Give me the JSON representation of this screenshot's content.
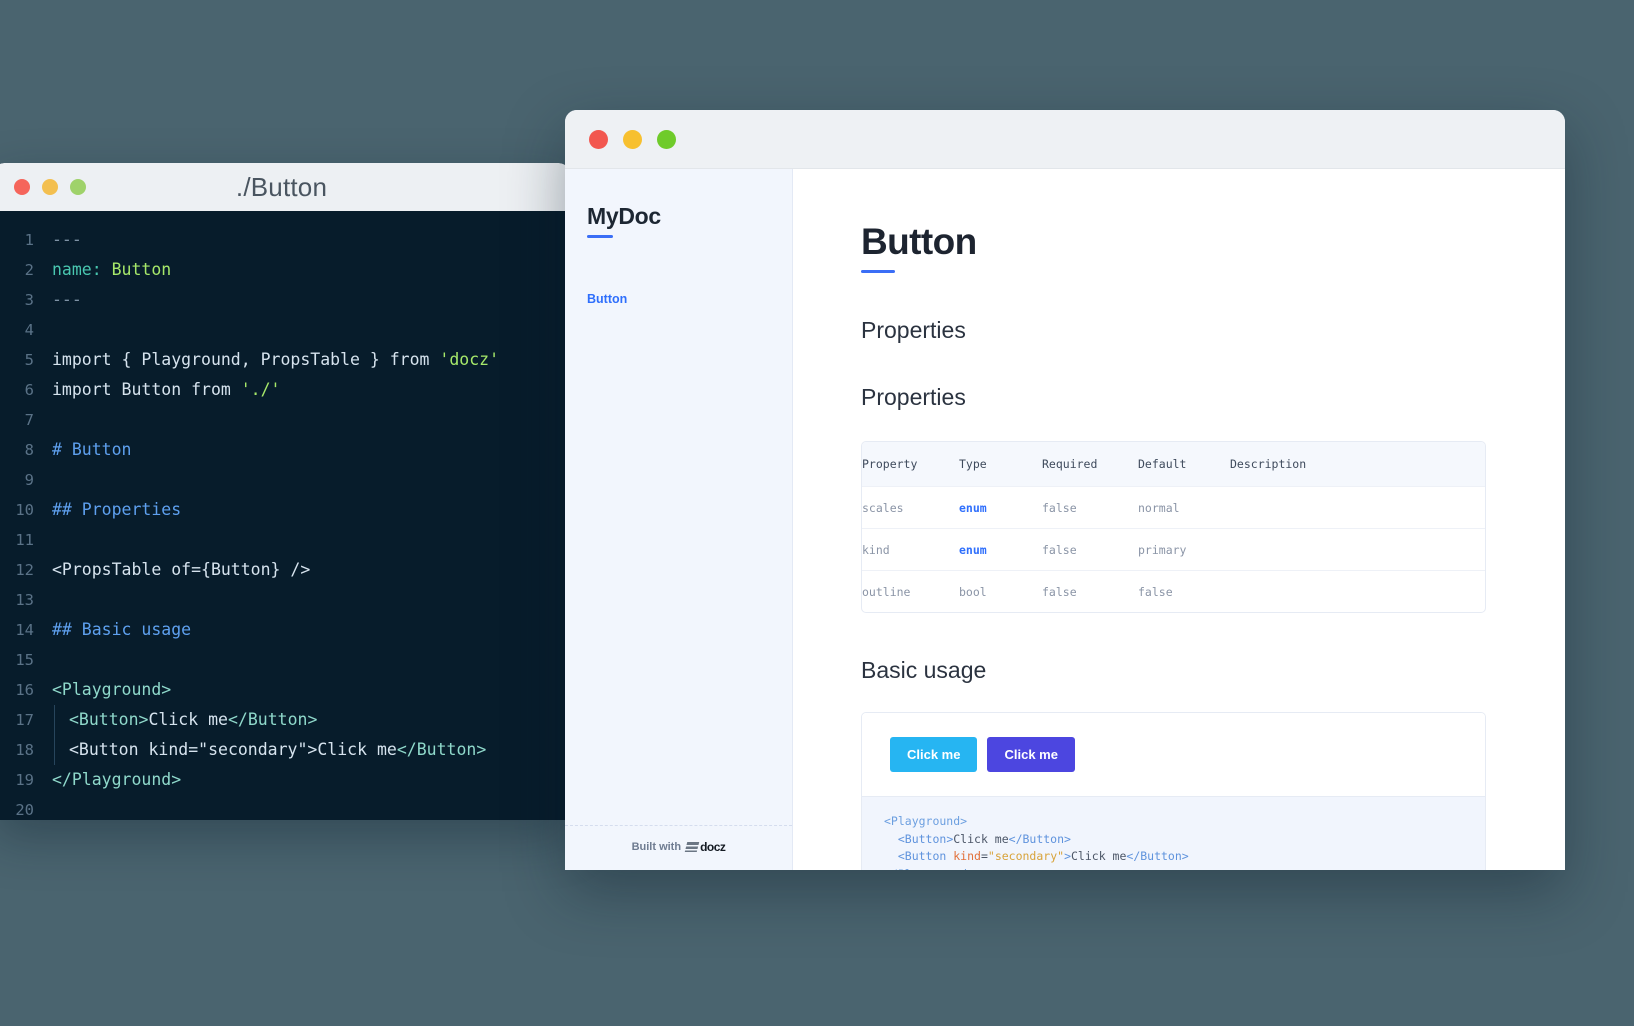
{
  "desktop": {
    "background_color": "#4a646f"
  },
  "editor": {
    "title": "./Button",
    "traffic_lights": [
      "close-red",
      "minimize-yellow",
      "maximize-green"
    ],
    "lines": [
      {
        "n": "1",
        "segs": [
          {
            "t": "---",
            "c": "tok-dim"
          }
        ]
      },
      {
        "n": "2",
        "segs": [
          {
            "t": "name:",
            "c": "tok-key"
          },
          {
            "t": " ",
            "c": "tok-punct"
          },
          {
            "t": "Button",
            "c": "tok-str"
          }
        ]
      },
      {
        "n": "3",
        "segs": [
          {
            "t": "---",
            "c": "tok-dim"
          }
        ]
      },
      {
        "n": "4",
        "segs": []
      },
      {
        "n": "5",
        "segs": [
          {
            "t": "import { Playground, PropsTable } from ",
            "c": "tok-kw"
          },
          {
            "t": "'docz'",
            "c": "tok-str"
          }
        ]
      },
      {
        "n": "6",
        "segs": [
          {
            "t": "import Button from ",
            "c": "tok-kw"
          },
          {
            "t": "'./'",
            "c": "tok-str"
          }
        ]
      },
      {
        "n": "7",
        "segs": []
      },
      {
        "n": "8",
        "segs": [
          {
            "t": "# Button",
            "c": "tok-head"
          }
        ]
      },
      {
        "n": "9",
        "segs": []
      },
      {
        "n": "10",
        "segs": [
          {
            "t": "## Properties",
            "c": "tok-head"
          }
        ]
      },
      {
        "n": "11",
        "segs": []
      },
      {
        "n": "12",
        "segs": [
          {
            "t": "<PropsTable of={Button} />",
            "c": "tok-kw"
          }
        ]
      },
      {
        "n": "13",
        "segs": []
      },
      {
        "n": "14",
        "segs": [
          {
            "t": "## Basic usage",
            "c": "tok-head"
          }
        ]
      },
      {
        "n": "15",
        "segs": []
      },
      {
        "n": "16",
        "segs": [
          {
            "t": "<Playground>",
            "c": "tok-tag"
          }
        ]
      },
      {
        "n": "17",
        "indent": true,
        "segs": [
          {
            "t": "<Button>",
            "c": "tok-tag"
          },
          {
            "t": "Click me",
            "c": "tok-kw"
          },
          {
            "t": "</Button>",
            "c": "tok-tag"
          }
        ]
      },
      {
        "n": "18",
        "indent": true,
        "segs": [
          {
            "t": "<Button kind=",
            "c": "tok-kw"
          },
          {
            "t": "\"secondary\"",
            "c": "tok-kw"
          },
          {
            "t": ">",
            "c": "tok-kw"
          },
          {
            "t": "Click me",
            "c": "tok-kw"
          },
          {
            "t": "</Button>",
            "c": "tok-tag"
          }
        ]
      },
      {
        "n": "19",
        "segs": [
          {
            "t": "</Playground>",
            "c": "tok-tag"
          }
        ]
      },
      {
        "n": "20",
        "segs": []
      }
    ]
  },
  "docz": {
    "traffic_lights": [
      "close-red",
      "minimize-yellow",
      "maximize-green"
    ],
    "sidebar": {
      "brand": "MyDoc",
      "nav_items": [
        {
          "label": "Button",
          "active": true
        }
      ],
      "footer": {
        "built_with": "Built with",
        "logo_text": "docz"
      }
    },
    "main": {
      "page_title": "Button",
      "section_properties_1": "Properties",
      "section_properties_2": "Properties",
      "section_basic_usage": "Basic usage",
      "props_table": {
        "columns": [
          "Property",
          "Type",
          "Required",
          "Default",
          "Description"
        ],
        "rows": [
          {
            "property": "scales",
            "type": "enum",
            "type_is_enum": true,
            "required": "false",
            "default": "normal",
            "description": ""
          },
          {
            "property": "kind",
            "type": "enum",
            "type_is_enum": true,
            "required": "false",
            "default": "primary",
            "description": ""
          },
          {
            "property": "outline",
            "type": "bool",
            "type_is_enum": false,
            "required": "false",
            "default": "false",
            "description": ""
          }
        ]
      },
      "playground": {
        "buttons": [
          {
            "label": "Click me",
            "kind": "primary",
            "color": "#26b5f2"
          },
          {
            "label": "Click me",
            "kind": "secondary",
            "color": "#4c46e0"
          }
        ],
        "code_lines": [
          [
            {
              "t": "<Playground>",
              "c": "pg-tag"
            }
          ],
          [
            {
              "t": "  ",
              "c": "pg-txt"
            },
            {
              "t": "<Button>",
              "c": "pg-tag2"
            },
            {
              "t": "Click me",
              "c": "pg-txt"
            },
            {
              "t": "</Button>",
              "c": "pg-tag2"
            }
          ],
          [
            {
              "t": "  ",
              "c": "pg-txt"
            },
            {
              "t": "<Button ",
              "c": "pg-tag2"
            },
            {
              "t": "kind",
              "c": "pg-attr"
            },
            {
              "t": "=",
              "c": "pg-txt"
            },
            {
              "t": "\"secondary\"",
              "c": "pg-str"
            },
            {
              "t": ">",
              "c": "pg-tag2"
            },
            {
              "t": "Click me",
              "c": "pg-txt"
            },
            {
              "t": "</Button>",
              "c": "pg-tag2"
            }
          ],
          [
            {
              "t": "</Playground>",
              "c": "pg-tag"
            }
          ]
        ]
      }
    }
  },
  "colors": {
    "accent_blue": "#3b6ef6",
    "link_blue": "#2f6ffc",
    "primary_button": "#26b5f2",
    "secondary_button": "#4c46e0",
    "editor_bg": "#071c2b",
    "sidebar_bg": "#f2f6fd"
  }
}
